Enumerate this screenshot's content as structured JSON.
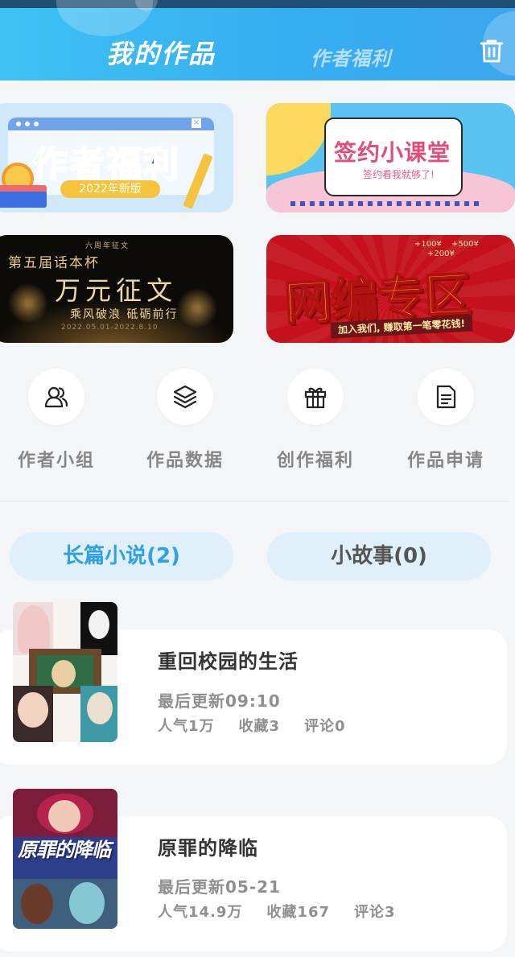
{
  "header": {
    "tabs": [
      {
        "label": "我的作品",
        "active": true
      },
      {
        "label": "作者福利",
        "active": false
      }
    ],
    "trash_icon": "trash-icon"
  },
  "banners": [
    {
      "title": "作者福利",
      "subtitle": "2022年新版"
    },
    {
      "title": "签约小课堂",
      "subtitle": "签约看我就够了!"
    },
    {
      "top_label": "六周年征文",
      "corner": "第五届话本杯",
      "title": "万元征文",
      "subtitle": "乘风破浪 砥砺前行",
      "date": "2022.05.01-2022.8.10"
    },
    {
      "title": "网编专区",
      "subtitle": "加入我们, 赚取第一笔零花钱!",
      "money": [
        "+100¥",
        "+500¥",
        "+200¥"
      ]
    }
  ],
  "actions": [
    {
      "label": "作者小组",
      "icon": "users-icon"
    },
    {
      "label": "作品数据",
      "icon": "layers-icon"
    },
    {
      "label": "创作福利",
      "icon": "gift-icon"
    },
    {
      "label": "作品申请",
      "icon": "document-icon"
    }
  ],
  "tabs": [
    {
      "label": "长篇小说(2)",
      "active": true
    },
    {
      "label": "小故事(0)",
      "active": false
    }
  ],
  "novels": [
    {
      "title": "重回校园的生活",
      "updated": "最后更新09:10",
      "popularity": "人气1万",
      "favorites": "收藏3",
      "comments": "评论0"
    },
    {
      "title": "原罪的降临",
      "updated": "最后更新05-21",
      "popularity": "人气14.9万",
      "favorites": "收藏167",
      "comments": "评论3",
      "cover_text": "原罪的降临"
    }
  ],
  "colors": {
    "header_gradient_start": "#3ec2f3",
    "header_gradient_end": "#3aa6ee",
    "active_tab_text": "#2f9fe7",
    "tab_bg": "#dff0fb",
    "muted_text": "#868686"
  }
}
